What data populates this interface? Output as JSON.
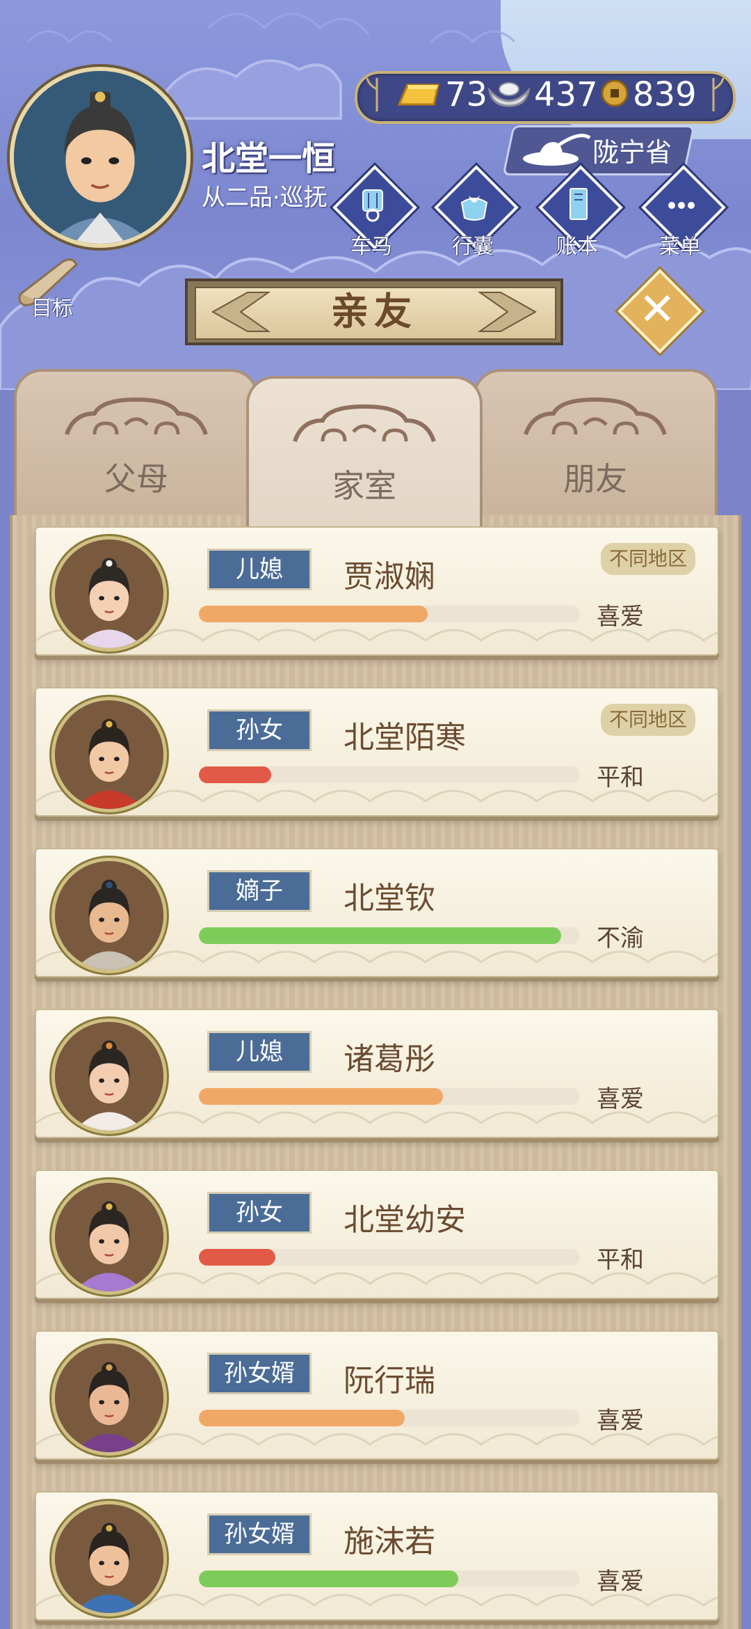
{
  "player": {
    "name": "北堂一恒",
    "rank": "从二品·巡抚"
  },
  "currency": {
    "gold": "73",
    "silver": "437",
    "coins": "839"
  },
  "region": "陇宁省",
  "nav": [
    {
      "label": "车马",
      "icon": "carriage-icon"
    },
    {
      "label": "行囊",
      "icon": "bundle-icon"
    },
    {
      "label": "账本",
      "icon": "ledger-icon"
    },
    {
      "label": "菜单",
      "icon": "more-dots-icon"
    }
  ],
  "goal_label": "目标",
  "title": "亲友",
  "tabs": [
    {
      "label": "父母",
      "active": false
    },
    {
      "label": "家室",
      "active": true
    },
    {
      "label": "朋友",
      "active": false
    }
  ],
  "members": [
    {
      "relation": "儿媳",
      "name": "贾淑娴",
      "mood": "喜爱",
      "affinity": 0.6,
      "bar_color": "#f1a866",
      "region_tag": "不同地区"
    },
    {
      "relation": "孙女",
      "name": "北堂陌寒",
      "mood": "平和",
      "affinity": 0.19,
      "bar_color": "#e25a47",
      "region_tag": "不同地区"
    },
    {
      "relation": "嫡子",
      "name": "北堂钦",
      "mood": "不渝",
      "affinity": 0.95,
      "bar_color": "#7dcc5a",
      "region_tag": ""
    },
    {
      "relation": "儿媳",
      "name": "诸葛彤",
      "mood": "喜爱",
      "affinity": 0.64,
      "bar_color": "#f1a866",
      "region_tag": ""
    },
    {
      "relation": "孙女",
      "name": "北堂幼安",
      "mood": "平和",
      "affinity": 0.2,
      "bar_color": "#e25a47",
      "region_tag": ""
    },
    {
      "relation": "孙女婿",
      "name": "阮行瑞",
      "mood": "喜爱",
      "affinity": 0.54,
      "bar_color": "#f1a866",
      "region_tag": ""
    },
    {
      "relation": "孙女婿",
      "name": "施沫若",
      "mood": "喜爱",
      "affinity": 0.68,
      "bar_color": "#7dcc5a",
      "region_tag": ""
    }
  ]
}
